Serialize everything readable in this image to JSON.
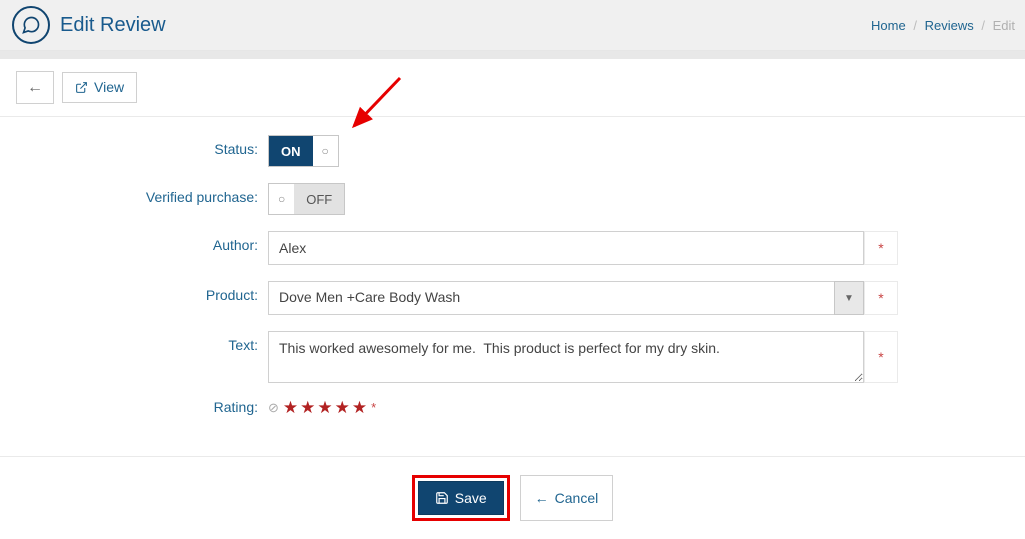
{
  "header": {
    "title": "Edit Review"
  },
  "breadcrumb": {
    "home": "Home",
    "reviews": "Reviews",
    "current": "Edit"
  },
  "toolbar": {
    "view": "View"
  },
  "labels": {
    "status": "Status:",
    "verified": "Verified purchase:",
    "author": "Author:",
    "product": "Product:",
    "text": "Text:",
    "rating": "Rating:"
  },
  "toggles": {
    "status_on": "ON",
    "verified_off": "OFF"
  },
  "fields": {
    "author": "Alex",
    "product": "Dove Men +Care Body Wash",
    "text": "This worked awesomely for me.  This product is perfect for my dry skin."
  },
  "rating": {
    "value": 5,
    "required": "*"
  },
  "required_marker": "*",
  "actions": {
    "save": "Save",
    "cancel": "Cancel"
  }
}
